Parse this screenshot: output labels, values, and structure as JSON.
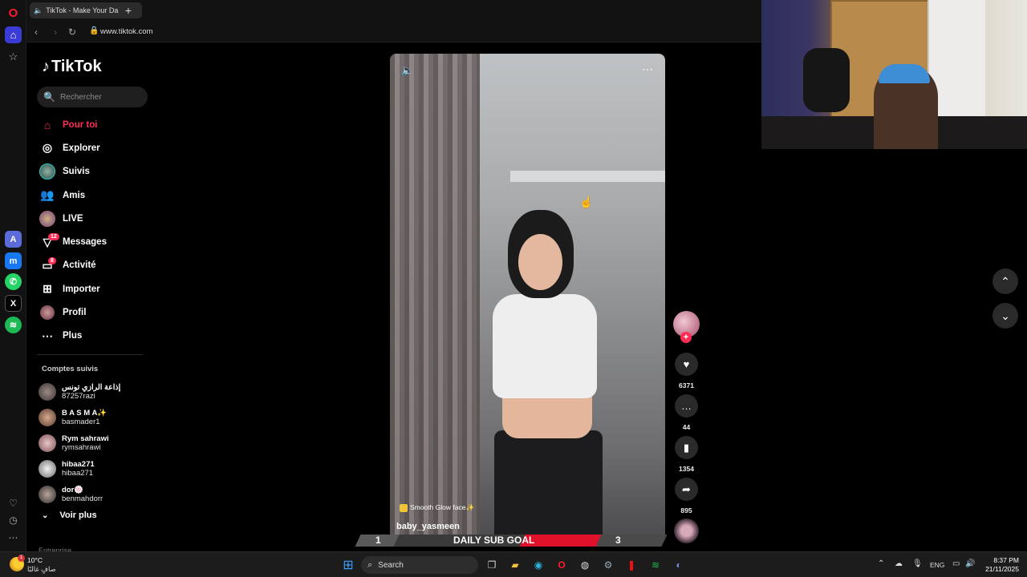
{
  "browser": {
    "tab_title": "TikTok - Make Your Da",
    "url": "www.tiktok.com"
  },
  "tiktok": {
    "logo_text": "TikTok",
    "search_placeholder": "Rechercher",
    "nav": [
      {
        "label": "Pour toi",
        "icon": "home-icon"
      },
      {
        "label": "Explorer",
        "icon": "compass-icon"
      },
      {
        "label": "Suivis",
        "icon": "following-avatar-icon"
      },
      {
        "label": "Amis",
        "icon": "friends-icon"
      },
      {
        "label": "LIVE",
        "icon": "live-icon"
      },
      {
        "label": "Messages",
        "icon": "messages-icon",
        "badge": "12"
      },
      {
        "label": "Activité",
        "icon": "activity-icon",
        "badge": "8"
      },
      {
        "label": "Importer",
        "icon": "upload-icon"
      },
      {
        "label": "Profil",
        "icon": "profile-icon"
      },
      {
        "label": "Plus",
        "icon": "more-icon"
      }
    ],
    "followed_title": "Comptes suivis",
    "followed": [
      {
        "name": "إذاعة الرازي تونس",
        "handle": "87257razi"
      },
      {
        "name": "B A S M A✨",
        "handle": "basmader1"
      },
      {
        "name": "Rym sahrawi",
        "handle": "rymsahrawi"
      },
      {
        "name": "hibaa271",
        "handle": "hibaa271"
      },
      {
        "name": "dor🍥",
        "handle": "benmahdorr"
      }
    ],
    "see_more": "Voir plus",
    "footer_section": "Entreprise",
    "video": {
      "effect": "Smooth Glow face✨",
      "author": "baby_yasmeen",
      "likes": "6371",
      "comments": "44",
      "saves": "1354",
      "shares": "895"
    }
  },
  "overlay": {
    "sub_goal_label": "DAILY SUB GOAL",
    "sub_goal_current": "1",
    "sub_goal_target": "3"
  },
  "taskbar": {
    "temperature": "10°C",
    "weather_desc": "صافٍ غالبًا",
    "weather_badge": "1",
    "search_label": "Search",
    "language": "ENG",
    "time": "8:37 PM",
    "date": "21/11/2025"
  },
  "colors": {
    "tiktok_red": "#fe2c55",
    "opera_red": "#ff1b2d",
    "opera_home_blue": "#3b3bd6"
  }
}
